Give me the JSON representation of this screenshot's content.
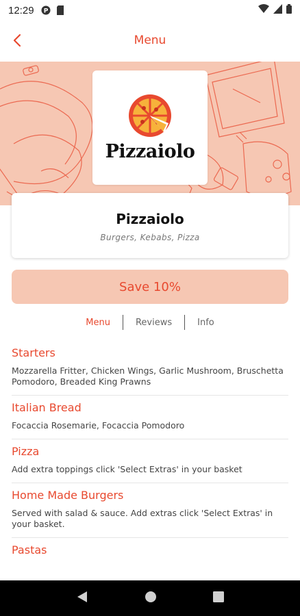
{
  "status_bar": {
    "time": "12:29"
  },
  "header": {
    "title": "Menu"
  },
  "restaurant": {
    "logo_text": "Pizzaiolo",
    "name": "Pizzaiolo",
    "cuisine": "Burgers, Kebabs, Pizza"
  },
  "save_button": {
    "label": "Save 10%"
  },
  "tabs": [
    {
      "label": "Menu",
      "active": true
    },
    {
      "label": "Reviews",
      "active": false
    },
    {
      "label": "Info",
      "active": false
    }
  ],
  "categories": [
    {
      "title": "Starters",
      "desc": "Mozzarella Fritter, Chicken Wings, Garlic Mushroom, Bruschetta Pomodoro, Breaded King Prawns"
    },
    {
      "title": "Italian Bread",
      "desc": "Focaccia Rosemarie, Focaccia Pomodoro"
    },
    {
      "title": "Pizza",
      "desc": "Add extra toppings click 'Select Extras' in your basket"
    },
    {
      "title": "Home Made Burgers",
      "desc": "Served with salad & sauce. Add extras click 'Select Extras' in your basket."
    },
    {
      "title": "Pastas",
      "desc": ""
    }
  ],
  "colors": {
    "accent": "#e8492f",
    "hero_bg": "#f6c7b3",
    "save_bg": "#f6c7b3"
  },
  "icons": {
    "back": "chevron-left-icon",
    "wifi": "wifi-icon",
    "signal": "signal-icon",
    "battery": "battery-icon",
    "nav_back": "nav-back-icon",
    "nav_home": "nav-home-icon",
    "nav_recents": "nav-recents-icon"
  }
}
